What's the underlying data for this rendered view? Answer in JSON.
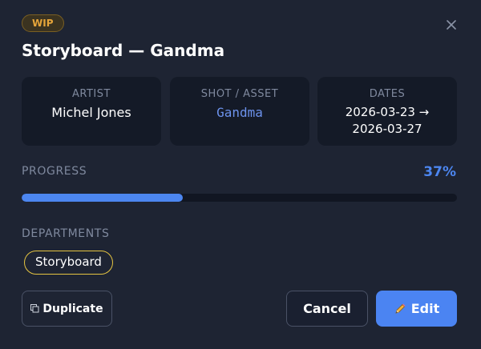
{
  "header": {
    "status_badge": "WIP",
    "title": "Storyboard — Gandma"
  },
  "info_cards": {
    "artist": {
      "label": "ARTIST",
      "value": "Michel Jones"
    },
    "shot_asset": {
      "label": "SHOT / ASSET",
      "value": "Gandma"
    },
    "dates": {
      "label": "DATES",
      "start": "2026-03-23 →",
      "end": "2026-03-27"
    }
  },
  "progress": {
    "label": "PROGRESS",
    "value_text": "37%",
    "fraction": 0.37
  },
  "departments": {
    "label": "DEPARTMENTS",
    "items": [
      "Storyboard"
    ]
  },
  "actions": {
    "duplicate_label": "Duplicate",
    "cancel_label": "Cancel",
    "edit_label": "Edit"
  },
  "colors": {
    "background": "#1e2433",
    "card": "#141a27",
    "accent": "#4c86f0",
    "status_wip": "#e6a53a",
    "department_outline": "#e5c441"
  },
  "icons": {
    "close": "close-icon",
    "duplicate": "duplicate-icon",
    "edit": "pencil-icon"
  }
}
